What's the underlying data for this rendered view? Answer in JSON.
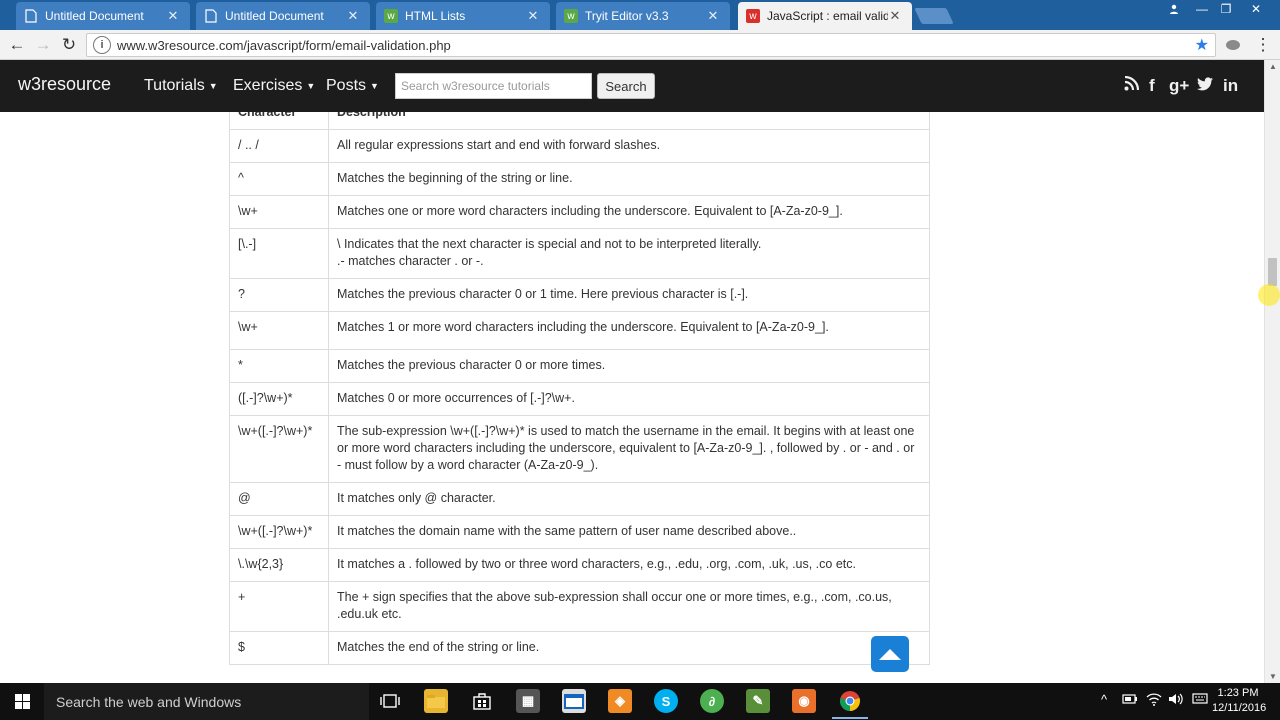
{
  "browser": {
    "tabs": [
      {
        "title": "Untitled Document",
        "active": false,
        "icon": "page-icon"
      },
      {
        "title": "Untitled Document",
        "active": false,
        "icon": "page-icon"
      },
      {
        "title": "HTML Lists",
        "active": false,
        "icon": "w3schools-icon"
      },
      {
        "title": "Tryit Editor v3.3",
        "active": false,
        "icon": "w3schools-icon"
      },
      {
        "title": "JavaScript : email validati",
        "active": true,
        "icon": "w3resource-icon"
      }
    ],
    "url": "www.w3resource.com/javascript/form/email-validation.php"
  },
  "site": {
    "brand": "w3resource",
    "menu": {
      "tutorials": "Tutorials",
      "exercises": "Exercises",
      "posts": "Posts"
    },
    "search": {
      "placeholder": "Search w3resource tutorials",
      "button": "Search"
    },
    "social": [
      "rss-icon",
      "facebook-icon",
      "google-plus-icon",
      "twitter-icon",
      "linkedin-icon"
    ]
  },
  "table": {
    "headers": {
      "character": "Character",
      "description": "Description"
    },
    "rows": [
      {
        "char": "/ .. /",
        "desc": "All regular expressions start and end with forward slashes."
      },
      {
        "char": "^",
        "desc": "Matches the beginning of the string or line."
      },
      {
        "char": "\\w+",
        "desc": "Matches one or more word characters including the underscore. Equivalent to [A-Za-z0-9_]."
      },
      {
        "char": "[\\.-]",
        "desc": "\\ Indicates that the next character is special and not to be interpreted literally.",
        "desc2": ".- matches character . or -."
      },
      {
        "char": "?",
        "desc": "Matches the previous character 0 or 1 time. Here previous character is [.-]."
      },
      {
        "char": "\\w+",
        "desc": "Matches 1 or more word characters including the underscore. Equivalent to [A-Za-z0-9_]."
      },
      {
        "char": "*",
        "desc": "Matches the previous character 0 or more times."
      },
      {
        "char": "([.-]?\\w+)*",
        "desc": "Matches 0 or more occurrences of [.-]?\\w+."
      },
      {
        "char": "\\w+([.-]?\\w+)*",
        "desc": "The sub-expression \\w+([.-]?\\w+)* is used to match the username in the email. It begins with at least one or more word characters including the underscore, equivalent to [A-Za-z0-9_]. , followed by . or - and . or - must follow by a word character (A-Za-z0-9_)."
      },
      {
        "char": "@",
        "desc": "It matches only @ character."
      },
      {
        "char": "\\w+([.-]?\\w+)*",
        "desc": "It matches the domain name with the same pattern of user name described above.."
      },
      {
        "char": "\\.\\w{2,3}",
        "desc": "It matches a . followed by two or three word characters, e.g., .edu, .org, .com, .uk, .us, .co etc."
      },
      {
        "char": "+",
        "desc": "The + sign specifies that the above sub-expression shall occur one or more times, e.g., .com, .co.us, .edu.uk etc."
      },
      {
        "char": "$",
        "desc": "Matches the end of the string or line."
      }
    ]
  },
  "taskbar": {
    "search_text": "Search the web and Windows",
    "time": "1:23 PM",
    "date": "12/11/2016"
  },
  "colors": {
    "tabstrip": "#1f5f9e",
    "navbar": "#1c1c1c",
    "scroll_top": "#1a80d6"
  }
}
